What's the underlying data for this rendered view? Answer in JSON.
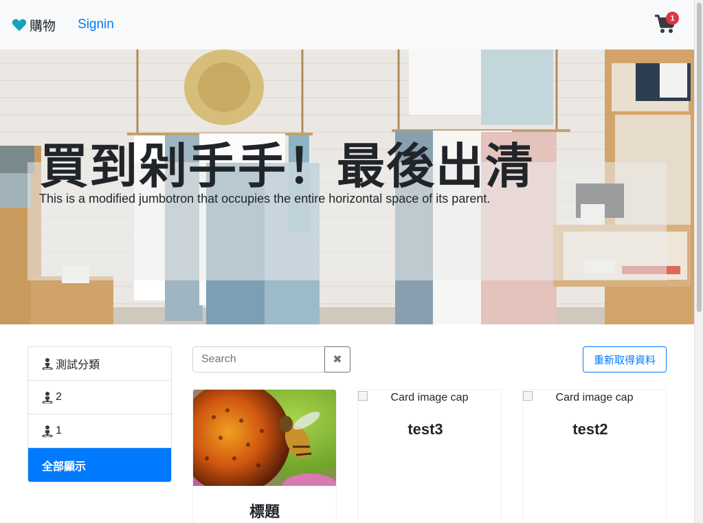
{
  "navbar": {
    "brand_icon": "heart-icon",
    "brand": "購物",
    "signin": "Signin",
    "cart_icon": "cart-icon",
    "cart_count": "1"
  },
  "hero": {
    "title": "買到剁手手！最後出清",
    "subtitle": "This is a modified jumbotron that occupies the entire horizontal space of its parent."
  },
  "categories": [
    {
      "icon": "person-icon",
      "label": "測試分類"
    },
    {
      "icon": "person-icon",
      "label": "2"
    },
    {
      "icon": "person-icon",
      "label": "1"
    },
    {
      "label": "全部顯示",
      "active": true
    }
  ],
  "search": {
    "placeholder": "Search",
    "clear_icon": "close-icon"
  },
  "refresh_label": "重新取得資料",
  "cards": [
    {
      "image": "bee-on-flower-photo",
      "title": "標題"
    },
    {
      "image_alt": "Card image cap",
      "title": "test3"
    },
    {
      "image_alt": "Card image cap",
      "title": "test2"
    }
  ],
  "colors": {
    "primary": "#007bff",
    "heart": "#17a2b8",
    "badge": "#dc3545",
    "navbar_bg": "#f8f9fa"
  }
}
